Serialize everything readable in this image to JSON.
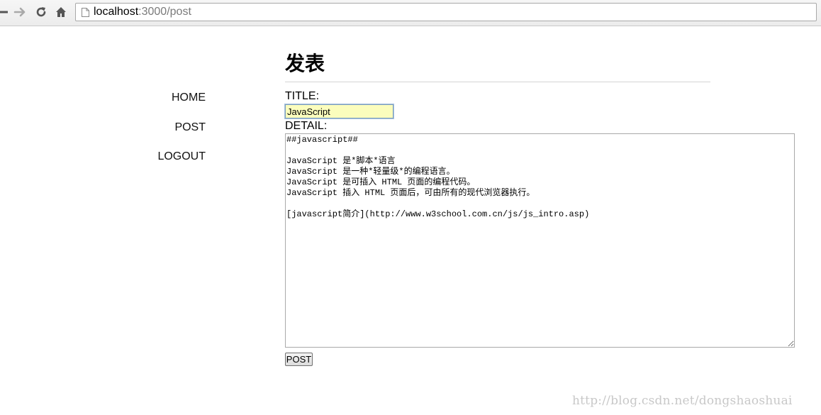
{
  "browser": {
    "url_host": "localhost",
    "url_path": ":3000/post",
    "icons": {
      "back": "back-arrow-icon",
      "forward": "forward-arrow-icon",
      "reload": "reload-icon",
      "home": "home-icon",
      "page": "page-icon"
    }
  },
  "page": {
    "heading": "发表"
  },
  "nav": {
    "items": [
      {
        "label": "HOME"
      },
      {
        "label": "POST"
      },
      {
        "label": "LOGOUT"
      }
    ]
  },
  "form": {
    "title_label": "TITLE:",
    "title_value": "JavaScript ",
    "detail_label": "DETAIL:",
    "detail_value": "##javascript##\n\nJavaScript 是*脚本*语言\nJavaScript 是一种*轻量级*的编程语言。\nJavaScript 是可插入 HTML 页面的编程代码。\nJavaScript 插入 HTML 页面后，可由所有的现代浏览器执行。\n\n[javascript简介](http://www.w3school.com.cn/js/js_intro.asp)",
    "submit_label": "POST"
  },
  "watermark": "http://blog.csdn.net/dongshaoshuai"
}
